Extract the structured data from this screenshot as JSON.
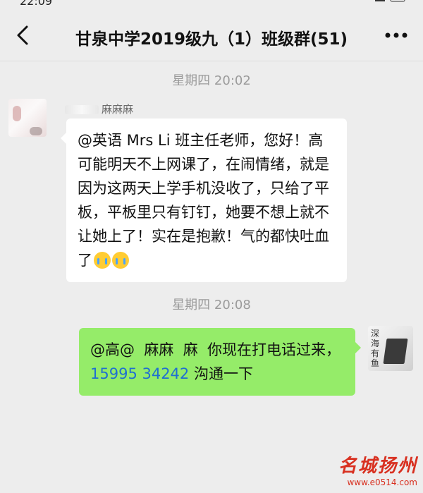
{
  "statusbar": {
    "time": "22:09"
  },
  "header": {
    "title": "甘泉中学2019级九（1）班级群(51)"
  },
  "messages": [
    {
      "timestamp": "星期四 20:02",
      "sender": "麻麻麻",
      "text": "@英语 Mrs Li 班主任老师，您好！高  可能明天不上网课了，在闹情绪，就是因为这两天上学手机没收了，只给了平板，平板里只有钉钉，她要不想上就不让她上了！实在是抱歉！气的都快吐血了"
    },
    {
      "timestamp": "星期四 20:08",
      "text_before_phone": "@高@  麻麻  麻  你现在打电话过来，",
      "phone": "15995 34242",
      "text_after_phone": " 沟通一下",
      "avatar_caption": "深海有鱼"
    }
  ],
  "watermark": {
    "logo": "名城扬州",
    "url": "www.e0514.com"
  },
  "colors": {
    "background": "#ededed",
    "bubble_self": "#95ec69",
    "bubble_other": "#ffffff",
    "phone_link": "#1f6fd1"
  },
  "icons": {
    "back": "chevron-left-icon",
    "more": "more-dots-icon",
    "emoji": "crying-face-icon"
  }
}
